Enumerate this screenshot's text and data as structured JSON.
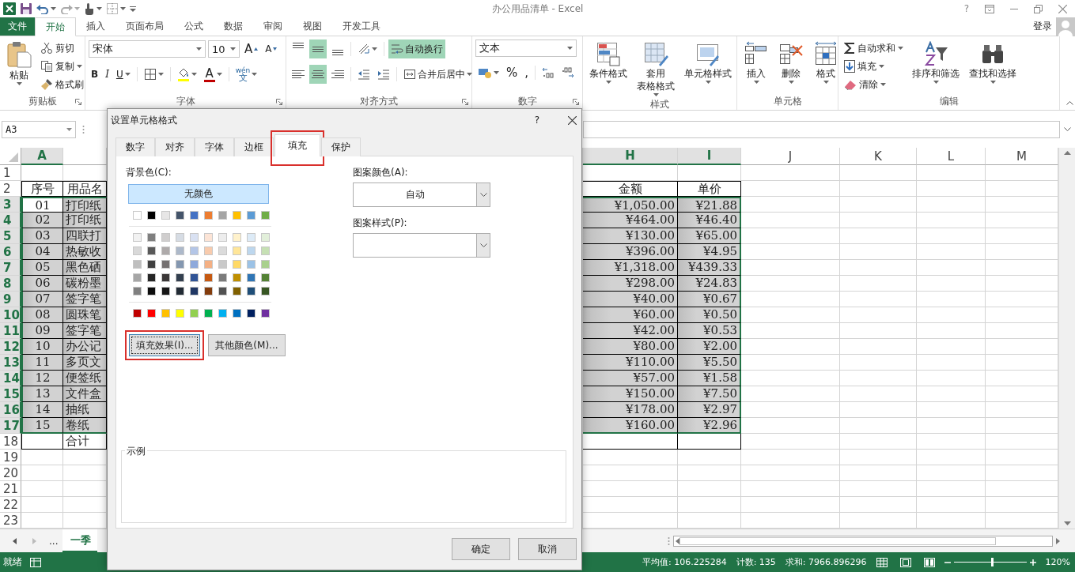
{
  "window": {
    "title": "办公用品清单 - Excel",
    "help": "?",
    "sign_in": "登录"
  },
  "ribbon_tabs": [
    {
      "label": "文件",
      "kind": "file",
      "selected": false
    },
    {
      "label": "开始",
      "kind": "tab",
      "selected": true
    },
    {
      "label": "插入",
      "kind": "tab",
      "selected": false
    },
    {
      "label": "页面布局",
      "kind": "tab",
      "selected": false
    },
    {
      "label": "公式",
      "kind": "tab",
      "selected": false
    },
    {
      "label": "数据",
      "kind": "tab",
      "selected": false
    },
    {
      "label": "审阅",
      "kind": "tab",
      "selected": false
    },
    {
      "label": "视图",
      "kind": "tab",
      "selected": false
    },
    {
      "label": "开发工具",
      "kind": "tab",
      "selected": false
    }
  ],
  "clipboard": {
    "group": "剪贴板",
    "paste": "粘贴",
    "cut": "剪切",
    "copy": "复制",
    "format_painter": "格式刷"
  },
  "font": {
    "group": "字体",
    "family": "宋体",
    "size": "10",
    "grow": "A",
    "shrink": "A",
    "bold": "B",
    "italic": "I",
    "underline": "U",
    "font_color": "A",
    "phonetic_top": "wén",
    "phonetic_bottom": "文"
  },
  "alignment": {
    "group": "对齐方式",
    "wrap_text": {
      "label": "自动换行",
      "on": true
    },
    "merge": "合并后居中",
    "align_buttons": [
      {
        "kind": "top",
        "selected": false
      },
      {
        "kind": "middle",
        "selected": true
      },
      {
        "kind": "bottom",
        "selected": false
      },
      {
        "kind": "left",
        "selected": false
      },
      {
        "kind": "center",
        "selected": true
      },
      {
        "kind": "right",
        "selected": false
      }
    ]
  },
  "number": {
    "group": "数字",
    "format": "文本",
    "percent": "%",
    "comma": ","
  },
  "styles": {
    "group": "样式",
    "conditional": "条件格式",
    "table_format_1": "套用",
    "table_format_2": "表格格式",
    "cell_styles": "单元格样式"
  },
  "cells": {
    "group": "单元格",
    "insert": "插入",
    "delete": "删除",
    "format": "格式"
  },
  "editing": {
    "group": "编辑",
    "autosum": "自动求和",
    "fill": "填充",
    "clear": "清除",
    "sort": "排序和筛选",
    "find": "查找和选择"
  },
  "name_box": "A3",
  "columns": [
    {
      "label": "A",
      "selected": true
    },
    {
      "label": "H",
      "selected": true
    },
    {
      "label": "I",
      "selected": true
    },
    {
      "label": "J",
      "selected": false
    },
    {
      "label": "K",
      "selected": false
    },
    {
      "label": "L",
      "selected": false
    },
    {
      "label": "M",
      "selected": false
    }
  ],
  "rows": [
    {
      "header": "1",
      "kind": "blank",
      "selected": false,
      "active": false
    },
    {
      "header": "2",
      "kind": "header",
      "selected": false,
      "active": false,
      "seq": "序号",
      "name": "用品名",
      "amount": "金额",
      "price": "单价"
    },
    {
      "header": "3",
      "kind": "item",
      "selected": true,
      "active": true,
      "seq": "01",
      "name": "打印纸",
      "amount": "¥1,050.00",
      "price": "¥21.88"
    },
    {
      "header": "4",
      "kind": "item",
      "selected": true,
      "active": false,
      "seq": "02",
      "name": "打印纸",
      "amount": "¥464.00",
      "price": "¥46.40"
    },
    {
      "header": "5",
      "kind": "item",
      "selected": true,
      "active": false,
      "seq": "03",
      "name": "四联打",
      "amount": "¥130.00",
      "price": "¥65.00"
    },
    {
      "header": "6",
      "kind": "item",
      "selected": true,
      "active": false,
      "seq": "04",
      "name": "热敏收",
      "amount": "¥396.00",
      "price": "¥4.95"
    },
    {
      "header": "7",
      "kind": "item",
      "selected": true,
      "active": false,
      "seq": "05",
      "name": "黑色硒",
      "amount": "¥1,318.00",
      "price": "¥439.33"
    },
    {
      "header": "8",
      "kind": "item",
      "selected": true,
      "active": false,
      "seq": "06",
      "name": "碳粉墨",
      "amount": "¥298.00",
      "price": "¥24.83"
    },
    {
      "header": "9",
      "kind": "item",
      "selected": true,
      "active": false,
      "seq": "07",
      "name": "签字笔",
      "amount": "¥40.00",
      "price": "¥0.67"
    },
    {
      "header": "10",
      "kind": "item",
      "selected": true,
      "active": false,
      "seq": "08",
      "name": "圆珠笔",
      "amount": "¥60.00",
      "price": "¥0.50"
    },
    {
      "header": "11",
      "kind": "item",
      "selected": true,
      "active": false,
      "seq": "09",
      "name": "签字笔",
      "amount": "¥42.00",
      "price": "¥0.53"
    },
    {
      "header": "12",
      "kind": "item",
      "selected": true,
      "active": false,
      "seq": "10",
      "name": "办公记",
      "amount": "¥80.00",
      "price": "¥2.00"
    },
    {
      "header": "13",
      "kind": "item",
      "selected": true,
      "active": false,
      "seq": "11",
      "name": "多页文",
      "amount": "¥110.00",
      "price": "¥5.50"
    },
    {
      "header": "14",
      "kind": "item",
      "selected": true,
      "active": false,
      "seq": "12",
      "name": "便签纸",
      "amount": "¥57.00",
      "price": "¥1.58"
    },
    {
      "header": "15",
      "kind": "item",
      "selected": true,
      "active": false,
      "seq": "13",
      "name": "文件盒",
      "amount": "¥150.00",
      "price": "¥7.50"
    },
    {
      "header": "16",
      "kind": "item",
      "selected": true,
      "active": false,
      "seq": "14",
      "name": "抽纸",
      "amount": "¥178.00",
      "price": "¥2.97"
    },
    {
      "header": "17",
      "kind": "item",
      "selected": true,
      "active": false,
      "seq": "15",
      "name": "卷纸",
      "amount": "¥160.00",
      "price": "¥2.96"
    },
    {
      "header": "18",
      "kind": "total",
      "selected": false,
      "active": false,
      "name": "合计"
    },
    {
      "header": "19",
      "kind": "blank",
      "selected": false,
      "active": false
    },
    {
      "header": "20",
      "kind": "blank",
      "selected": false,
      "active": false
    },
    {
      "header": "21",
      "kind": "blank",
      "selected": false,
      "active": false
    },
    {
      "header": "22",
      "kind": "blank",
      "selected": false,
      "active": false
    },
    {
      "header": "23",
      "kind": "blank",
      "selected": false,
      "active": false
    }
  ],
  "sheet_tabs": {
    "more": "...",
    "tabs": [
      {
        "label": "一季",
        "selected": true
      }
    ]
  },
  "status": {
    "ready": "就绪",
    "average": "平均值: 106.225284",
    "count": "计数: 135",
    "sum": "求和: 7966.896296",
    "zoom": {
      "label": "120%",
      "level": 0.53
    }
  },
  "dialog": {
    "title": "设置单元格格式",
    "help": "?",
    "tabs": [
      {
        "label": "数字",
        "selected": false,
        "highlighted": false
      },
      {
        "label": "对齐",
        "selected": false,
        "highlighted": false
      },
      {
        "label": "字体",
        "selected": false,
        "highlighted": false
      },
      {
        "label": "边框",
        "selected": false,
        "highlighted": false
      },
      {
        "label": "填充",
        "selected": true,
        "highlighted": true
      },
      {
        "label": "保护",
        "selected": false,
        "highlighted": false
      }
    ],
    "background_label": "背景色(C):",
    "no_color": {
      "label": "无颜色",
      "selected": true
    },
    "theme_colors": [
      {
        "color": "#ffffff"
      },
      {
        "color": "#000000"
      },
      {
        "color": "#e7e6e6"
      },
      {
        "color": "#44546a"
      },
      {
        "color": "#4472c4"
      },
      {
        "color": "#ed7d31"
      },
      {
        "color": "#a5a5a5"
      },
      {
        "color": "#ffc000"
      },
      {
        "color": "#5b9bd5"
      },
      {
        "color": "#70ad47"
      }
    ],
    "tint_rows": [
      [
        {
          "color": "#f2f2f2"
        },
        {
          "color": "#7f7f7f"
        },
        {
          "color": "#d0cece"
        },
        {
          "color": "#d6dce4"
        },
        {
          "color": "#d9e1f2"
        },
        {
          "color": "#fce4d6"
        },
        {
          "color": "#ededed"
        },
        {
          "color": "#fff2cc"
        },
        {
          "color": "#ddebf7"
        },
        {
          "color": "#e2efda"
        }
      ],
      [
        {
          "color": "#d9d9d9"
        },
        {
          "color": "#595959"
        },
        {
          "color": "#aeaaaa"
        },
        {
          "color": "#adb9ca"
        },
        {
          "color": "#b4c6e7"
        },
        {
          "color": "#f8cbad"
        },
        {
          "color": "#dbdbdb"
        },
        {
          "color": "#ffe699"
        },
        {
          "color": "#bdd7ee"
        },
        {
          "color": "#c6e0b4"
        }
      ],
      [
        {
          "color": "#bfbfbf"
        },
        {
          "color": "#404040"
        },
        {
          "color": "#757171"
        },
        {
          "color": "#8497b0"
        },
        {
          "color": "#8ea9db"
        },
        {
          "color": "#f4b084"
        },
        {
          "color": "#c9c9c9"
        },
        {
          "color": "#ffd966"
        },
        {
          "color": "#9bc2e6"
        },
        {
          "color": "#a9d08e"
        }
      ],
      [
        {
          "color": "#a6a6a6"
        },
        {
          "color": "#262626"
        },
        {
          "color": "#3b3838"
        },
        {
          "color": "#333f4f"
        },
        {
          "color": "#305496"
        },
        {
          "color": "#c65911"
        },
        {
          "color": "#7b7b7b"
        },
        {
          "color": "#bf8f00"
        },
        {
          "color": "#2f75b5"
        },
        {
          "color": "#548235"
        }
      ],
      [
        {
          "color": "#808080"
        },
        {
          "color": "#0d0d0d"
        },
        {
          "color": "#161616"
        },
        {
          "color": "#222b35"
        },
        {
          "color": "#203764"
        },
        {
          "color": "#833c0c"
        },
        {
          "color": "#525252"
        },
        {
          "color": "#806000"
        },
        {
          "color": "#1f4e78"
        },
        {
          "color": "#375623"
        }
      ]
    ],
    "standard_colors": [
      {
        "color": "#c00000"
      },
      {
        "color": "#ff0000"
      },
      {
        "color": "#ffc000"
      },
      {
        "color": "#ffff00"
      },
      {
        "color": "#92d050"
      },
      {
        "color": "#00b050"
      },
      {
        "color": "#00b0f0"
      },
      {
        "color": "#0070c0"
      },
      {
        "color": "#002060"
      },
      {
        "color": "#7030a0"
      }
    ],
    "fill_effects": {
      "label": "填充效果(I)...",
      "highlighted": true
    },
    "more_colors": "其他颜色(M)...",
    "pattern_color_label": "图案颜色(A):",
    "pattern_color": "自动",
    "pattern_style_label": "图案样式(P):",
    "sample_label": "示例",
    "ok": "确定",
    "cancel": "取消"
  }
}
